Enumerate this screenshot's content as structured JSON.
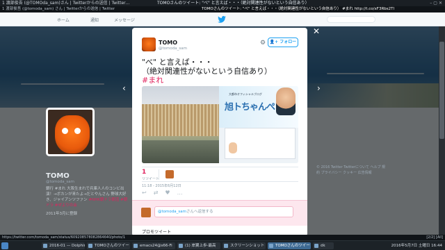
{
  "window": {
    "title_left": "1 渡部俊吾 (@TOMOda_sam)さん | Twitterからの送信 | Twitter…",
    "title_mid": "TOMOさんのツイート: \"べ\" と言えば・・・（絶対関連性がないという自信あり）",
    "tab_left": "1 渡部俊吾 (@tomoda_sam) さん | Twitterからの送信 | Twitter",
    "tab_right": "TOMOさんのツイート: \"べ\" と言えば・・・（絶対関連性がないという自信あり） #まれ http://t.co/xF3Rbs2Tl"
  },
  "nav": {
    "home": "ホーム",
    "notifications": "通知",
    "messages": "メッセージ"
  },
  "profile": {
    "name": "TOMO",
    "handle": "@tomoda_sam",
    "bio": "銀行 #まれ 大阪生まれで兵庫人人のコンビ出演！→ボカンが来たよ→だとやんさん 野球大好き、ジャイアンツファン",
    "bio_highlight": "#NHK朝ドラ朝活 #朝ドラ #ぜよりの会",
    "joined": "2011年3月に登録",
    "footer": "© 2016 Twitter  Twitterについて  ヘルプ  規約  プライバシー  クッキー  広告情報"
  },
  "modal": {
    "user_name": "TOMO",
    "user_handle": "@tomoda_sam",
    "follow_label": "フォロー",
    "tweet_line1": "\"べ\" と言えば・・・",
    "tweet_line2": "（絶対関連性がないという自信あり）",
    "tweet_tag": "#まれ",
    "image_title": "旭トちゃんぺ",
    "image_subtitle": "大都市オフィシャルブログ",
    "retweet_count": "1",
    "retweet_label": "リツイート",
    "timestamp": "11:18 - 2015年6月12日",
    "reply_mention": "@tomoda_sam",
    "reply_placeholder": "さんへ返信する",
    "promoted_label": "プロモツイート"
  },
  "statusbar": {
    "url": "https://twitter.com/tomoda_sam/status/609208578082864640/photo/1",
    "right": "[2/2] [All]"
  },
  "taskbar": {
    "tasks": [
      "2016-01 — Dolphin",
      "TOMOさんのツイート",
      "emacs24@s66-Fi",
      "(1) 岸翼上歩-最高",
      "スクリーンショット",
      "TOMOさんのツイート",
      "dk"
    ],
    "clock": "2016年5月7日 土曜日 16:44"
  }
}
